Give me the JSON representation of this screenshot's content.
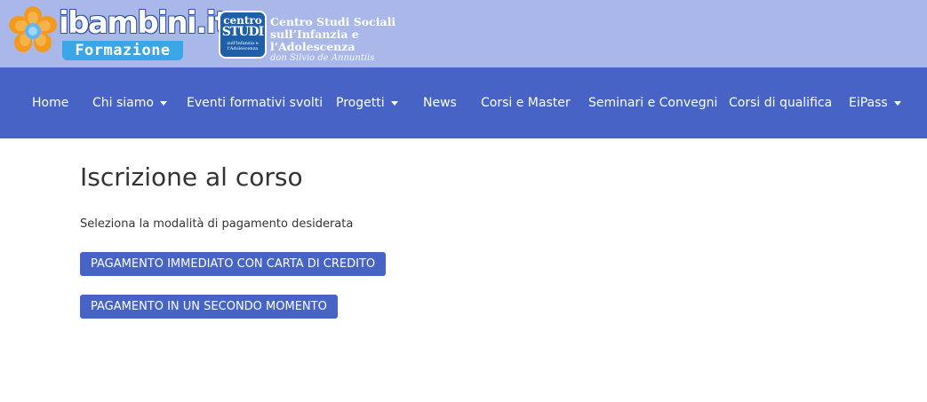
{
  "header": {
    "brand": {
      "name": "ibambini",
      "tld": ".it",
      "subtitle": "Formazione"
    },
    "partner": {
      "mark_top": "centro",
      "mark_mid": "STUDI",
      "mark_bottom": "sull'Infanzia e l'Adolescenza",
      "line1": "Centro Studi Sociali",
      "line2": "sull’Infanzia e l’Adolescenza",
      "line3": "don Silvio de Annuntiis"
    }
  },
  "nav": {
    "items": [
      {
        "label": "Home",
        "dropdown": false
      },
      {
        "label": "Chi siamo",
        "dropdown": true
      },
      {
        "label": "Eventi formativi svolti",
        "dropdown": false
      },
      {
        "label": "Progetti",
        "dropdown": true
      },
      {
        "label": "News",
        "dropdown": false
      },
      {
        "label": "Corsi e Master",
        "dropdown": false
      },
      {
        "label": "Seminari e Convegni",
        "dropdown": false
      },
      {
        "label": "Corsi di qualifica",
        "dropdown": false
      },
      {
        "label": "EiPass",
        "dropdown": true
      }
    ]
  },
  "main": {
    "title": "Iscrizione al corso",
    "intro": "Seleziona la modalità di pagamento desiderata",
    "buttons": {
      "card": "PAGAMENTO IMMEDIATO CON CARTA DI CREDITO",
      "later": "PAGAMENTO IN UN SECONDO MOMENTO"
    }
  },
  "colors": {
    "header_bg": "#a9b8e8",
    "nav_bg": "#4763c6",
    "button_bg": "#4763c6",
    "logo_blue": "#3aa6e6",
    "flower_orange": "#f39a1e"
  }
}
